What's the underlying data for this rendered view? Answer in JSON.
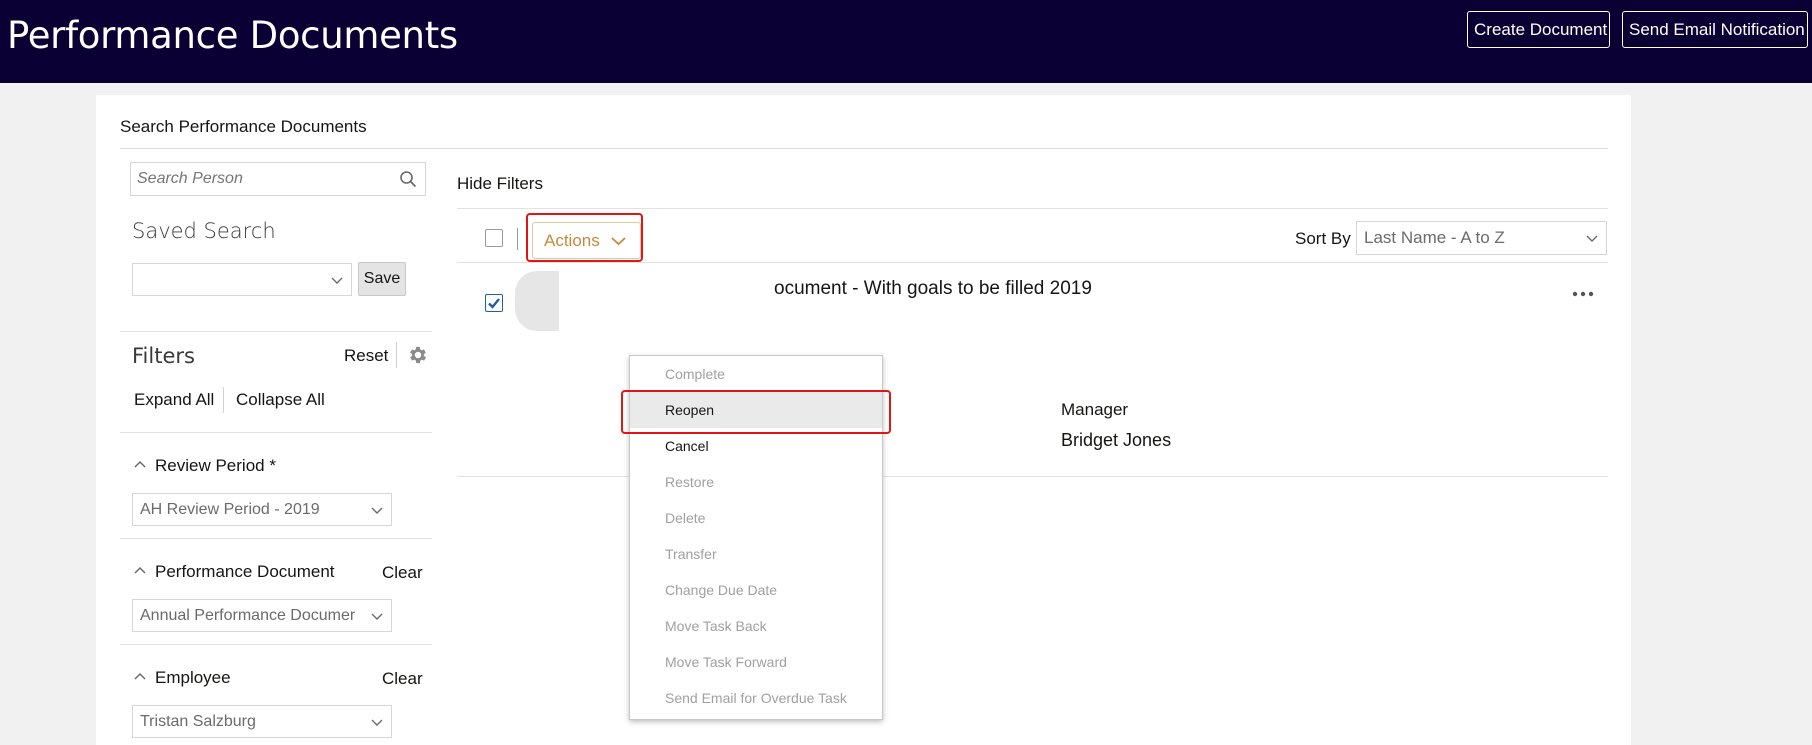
{
  "header": {
    "title": "Performance Documents",
    "create_document": "Create Document",
    "send_email": "Send Email Notification"
  },
  "panel": {
    "title": "Search Performance Documents"
  },
  "sidebar": {
    "search_placeholder": "Search Person",
    "saved_search_label": "Saved Search",
    "saved_search_value": "",
    "save_label": "Save",
    "filters_label": "Filters",
    "reset_label": "Reset",
    "expand_all": "Expand All",
    "collapse_all": "Collapse All",
    "review_period": {
      "label": "Review Period *",
      "value": "AH Review Period - 2019"
    },
    "performance_document": {
      "label": "Performance Document",
      "clear": "Clear",
      "value": "Annual Performance Documer"
    },
    "employee": {
      "label": "Employee",
      "clear": "Clear",
      "value": "Tristan Salzburg"
    }
  },
  "toolbar": {
    "hide_filters": "Hide Filters",
    "actions_label": "Actions",
    "sort_by_label": "Sort By",
    "sort_by_value": "Last Name - A to Z"
  },
  "document_row": {
    "title_visible": "ocument - With goals to be filled 2019",
    "manager_label": "Manager",
    "manager_name": "Bridget Jones",
    "selected": true
  },
  "actions_menu": {
    "items": [
      {
        "label": "Complete",
        "enabled": false
      },
      {
        "label": "Reopen",
        "enabled": true,
        "hovered": true
      },
      {
        "label": "Cancel",
        "enabled": true
      },
      {
        "label": "Restore",
        "enabled": false
      },
      {
        "label": "Delete",
        "enabled": false
      },
      {
        "label": "Transfer",
        "enabled": false
      },
      {
        "label": "Change Due Date",
        "enabled": false
      },
      {
        "label": "Move Task Back",
        "enabled": false
      },
      {
        "label": "Move Task Forward",
        "enabled": false
      },
      {
        "label": "Send Email for Overdue Task",
        "enabled": false
      }
    ]
  },
  "colors": {
    "header_bg": "#0a0033",
    "actions_accent": "#c48a3a",
    "highlight": "#e01616",
    "checkbox_blue": "#1f5fa8"
  }
}
